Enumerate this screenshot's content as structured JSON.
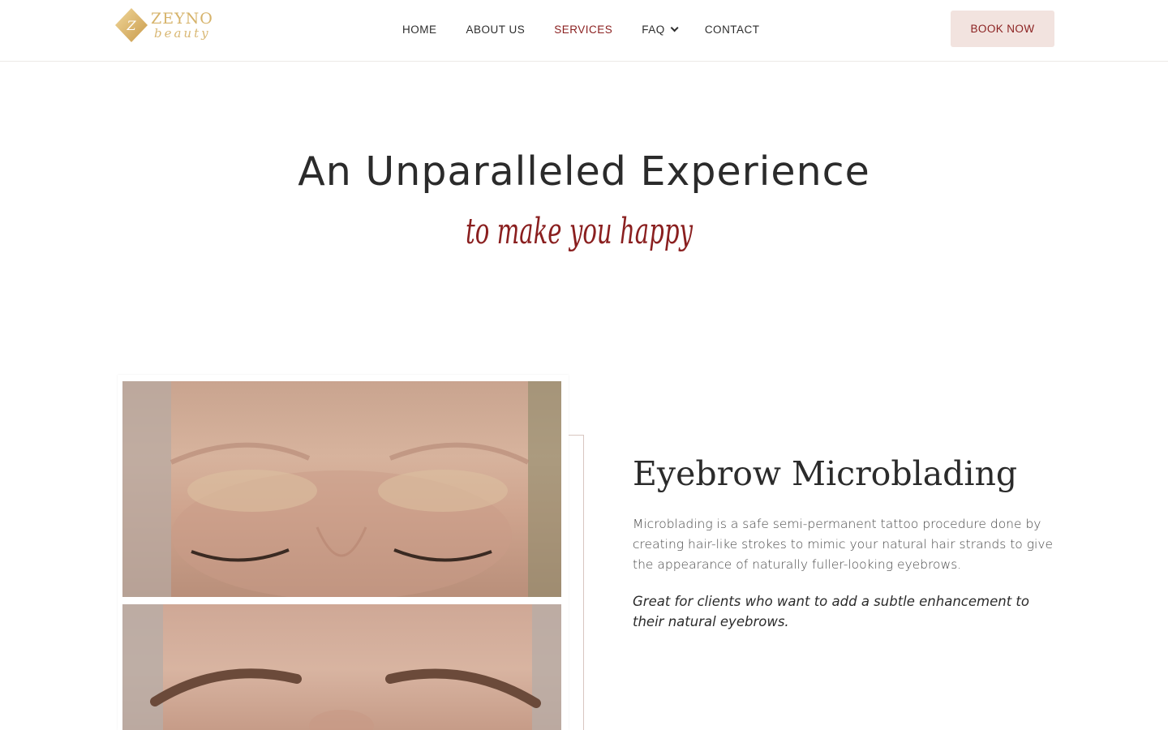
{
  "brand": {
    "logo_mark": "Z",
    "logo_word": "ZEYNO",
    "logo_script": "beauty",
    "gold": "#d6b36a"
  },
  "nav": {
    "items": [
      {
        "label": "HOME"
      },
      {
        "label": "ABOUT US"
      },
      {
        "label": "SERVICES",
        "active": true
      },
      {
        "label": "FAQ",
        "has_dropdown": true
      },
      {
        "label": "CONTACT"
      }
    ],
    "active_color": "#8a1f1f"
  },
  "header": {
    "book_label": "BOOK NOW",
    "book_bg": "#f2e3df"
  },
  "hero": {
    "title": "An Unparalleled Experience",
    "script": "to make you happy",
    "script_color": "#8a1f1f"
  },
  "service": {
    "title": "Eyebrow Microblading",
    "description": "Microblading is a safe semi-permanent tattoo procedure done by creating hair-like strokes to mimic your natural hair strands to give the appearance of naturally fuller-looking eyebrows.",
    "note": "Great for clients who want to add a subtle enhancement to their natural eyebrows."
  }
}
